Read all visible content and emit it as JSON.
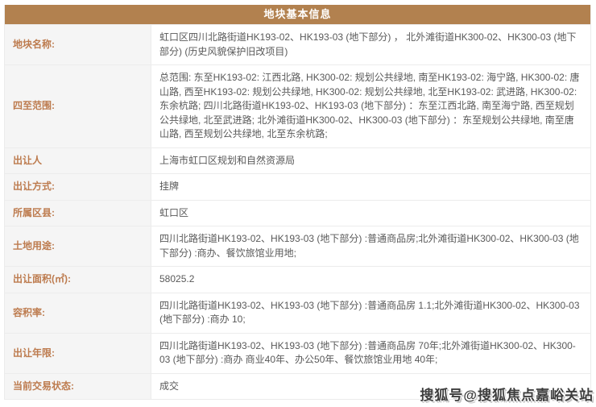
{
  "table": {
    "title": "地块基本信息",
    "rows": [
      {
        "label": "地块名称:",
        "value": "虹口区四川北路街道HK193-02、HK193-03 (地下部分) ， 北外滩街道HK300-02、HK300-03 (地下部分) (历史风貌保护旧改项目)"
      },
      {
        "label": "四至范围:",
        "value": "总范围: 东至HK193-02: 江西北路, HK300-02: 规划公共绿地, 南至HK193-02: 海宁路, HK300-02: 唐山路, 西至HK193-02: 规划公共绿地, HK300-02: 规划公共绿地, 北至HK193-02: 武进路, HK300-02: 东余杭路; 四川北路街道HK193-02、HK193-03 (地下部分) ：东至江西北路, 南至海宁路, 西至规划公共绿地, 北至武进路; 北外滩街道HK300-02、HK300-03 (地下部分) ：东至规划公共绿地, 南至唐山路, 西至规划公共绿地, 北至东余杭路;"
      },
      {
        "label": "出让人",
        "value": "上海市虹口区规划和自然资源局"
      },
      {
        "label": "出让方式:",
        "value": "挂牌"
      },
      {
        "label": "所属区县:",
        "value": "虹口区"
      },
      {
        "label": "土地用途:",
        "value": "四川北路街道HK193-02、HK193-03 (地下部分) :普通商品房;北外滩街道HK300-02、HK300-03 (地下部分) :商办、餐饮旅馆业用地;"
      },
      {
        "label": "出让面积(㎡):",
        "value": "58025.2"
      },
      {
        "label": "容积率:",
        "value": "四川北路街道HK193-02、HK193-03 (地下部分) :普通商品房 1.1;北外滩街道HK300-02、HK300-03 (地下部分) :商办 10;"
      },
      {
        "label": "出让年限:",
        "value": "四川北路街道HK193-02、HK193-03 (地下部分) :普通商品房 70年;北外滩街道HK300-02、HK300-03 (地下部分) :商办 商业40年、办公50年、餐饮旅馆业用地 40年;"
      },
      {
        "label": "当前交易状态:",
        "value": "成交"
      }
    ]
  },
  "watermark": {
    "text": "搜狐号@搜狐焦点嘉峪关站"
  },
  "colors": {
    "header_bg": "#b2814f",
    "header_text": "#ffffff",
    "label_text": "#bd7b4e",
    "label_bg": "#f5f5f5",
    "value_text": "#595959",
    "border": "#ececec"
  }
}
